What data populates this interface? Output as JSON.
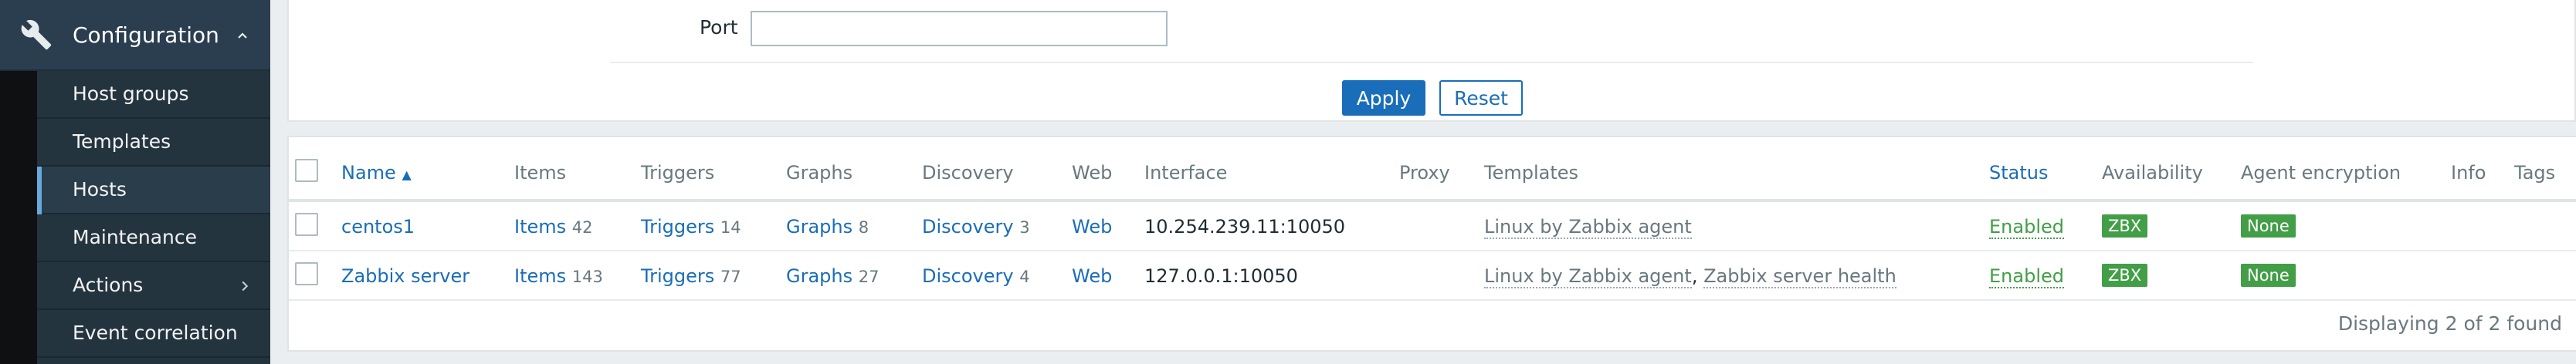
{
  "sidebar": {
    "section_title": "Configuration",
    "items": [
      {
        "label": "Host groups"
      },
      {
        "label": "Templates"
      },
      {
        "label": "Hosts"
      },
      {
        "label": "Maintenance"
      },
      {
        "label": "Actions"
      },
      {
        "label": "Event correlation"
      }
    ],
    "active_item": "Hosts"
  },
  "filter": {
    "port_label": "Port",
    "port_value": "",
    "apply_label": "Apply",
    "reset_label": "Reset"
  },
  "table": {
    "columns": {
      "name": "Name",
      "sort_arrow": "▲",
      "items": "Items",
      "triggers": "Triggers",
      "graphs": "Graphs",
      "discovery": "Discovery",
      "web": "Web",
      "interface": "Interface",
      "proxy": "Proxy",
      "templates": "Templates",
      "status": "Status",
      "availability": "Availability",
      "agent_encryption": "Agent encryption",
      "info": "Info",
      "tags": "Tags"
    },
    "rows": [
      {
        "name": "centos1",
        "items_label": "Items",
        "items_count": "42",
        "triggers_label": "Triggers",
        "triggers_count": "14",
        "graphs_label": "Graphs",
        "graphs_count": "8",
        "discovery_label": "Discovery",
        "discovery_count": "3",
        "web": "Web",
        "interface": "10.254.239.11:10050",
        "template_1": "Linux by Zabbix agent",
        "template_sep": "",
        "template_2": "",
        "status": "Enabled",
        "availability": "ZBX",
        "encryption": "None"
      },
      {
        "name": "Zabbix server",
        "items_label": "Items",
        "items_count": "143",
        "triggers_label": "Triggers",
        "triggers_count": "77",
        "graphs_label": "Graphs",
        "graphs_count": "27",
        "discovery_label": "Discovery",
        "discovery_count": "4",
        "web": "Web",
        "interface": "127.0.0.1:10050",
        "template_1": "Linux by Zabbix agent",
        "template_sep": ",",
        "template_2": "Zabbix server health",
        "status": "Enabled",
        "availability": "ZBX",
        "encryption": "None"
      }
    ],
    "footer": "Displaying 2 of 2 found"
  },
  "colors": {
    "accent": "#1a6db8",
    "status_enabled": "#429e47",
    "sidebar_bg": "#24343f",
    "sidebar_header_bg": "#2b3e50"
  },
  "icons": {
    "section": "wrench-icon",
    "collapse": "chevron-up-icon",
    "submenu": "chevron-right-icon",
    "sort": "sort-ascending-icon"
  }
}
